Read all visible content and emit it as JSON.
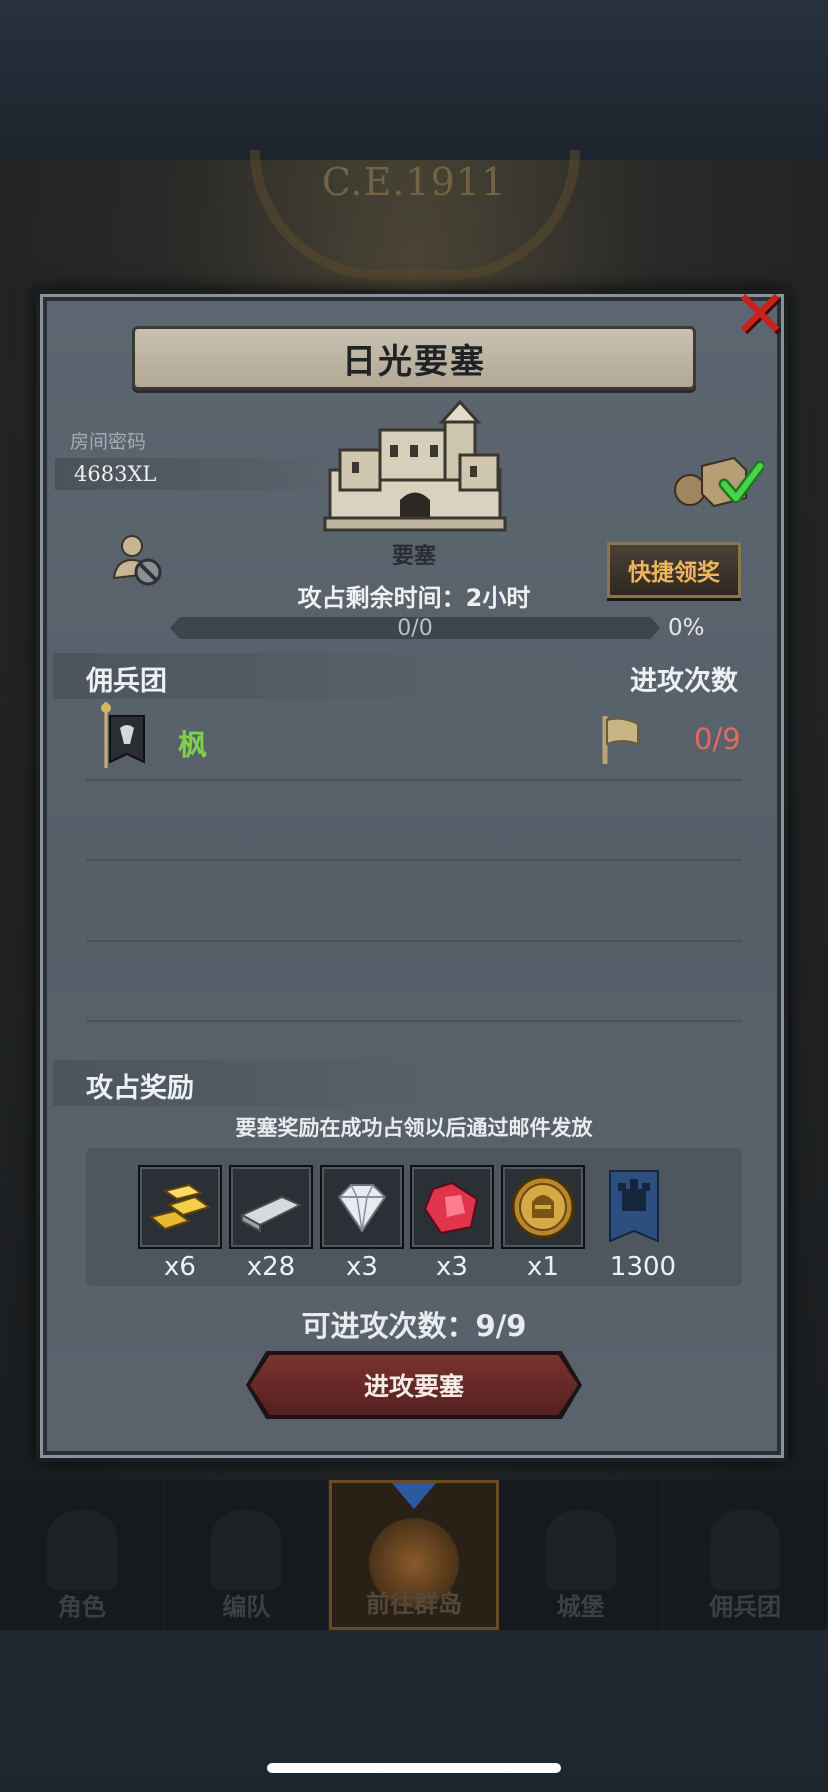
{
  "background": {
    "era_label": "C.E.1911"
  },
  "dialog": {
    "title": "日光要塞",
    "close_icon": "close-x-icon",
    "room": {
      "label": "房间密码",
      "code": "4683XL"
    },
    "fortress": {
      "label": "要塞",
      "time_left": "攻占剩余时间：2小时",
      "progress_text": "0/0",
      "progress_percent": "0%",
      "progress_value": 0
    },
    "quick_claim_label": "快捷领奖",
    "mercenary_section": {
      "title": "佣兵团",
      "attacks_header": "进攻次数",
      "rows": [
        {
          "name": "枫",
          "attacks": "0/9"
        }
      ]
    },
    "rewards_section": {
      "title": "攻占奖励",
      "note": "要塞奖励在成功占领以后通过邮件发放",
      "items": [
        {
          "icon": "gold-bars-icon",
          "qty": "x6"
        },
        {
          "icon": "silver-bar-icon",
          "qty": "x28"
        },
        {
          "icon": "diamond-icon",
          "qty": "x3"
        },
        {
          "icon": "ruby-icon",
          "qty": "x3"
        },
        {
          "icon": "knight-medal-icon",
          "qty": "x1"
        },
        {
          "icon": "castle-banner-icon",
          "qty": "1300"
        }
      ]
    },
    "attack_count": "可进攻次数：9/9",
    "attack_button": "进攻要塞"
  },
  "nav": {
    "items": [
      {
        "label": "角色",
        "icon": "knight-helmet-icon",
        "active": false
      },
      {
        "label": "编队",
        "icon": "formation-icon",
        "active": false
      },
      {
        "label": "前往群岛",
        "icon": "island-compass-icon",
        "active": true
      },
      {
        "label": "城堡",
        "icon": "castle-icon",
        "active": false
      },
      {
        "label": "佣兵团",
        "icon": "mercenary-icon",
        "active": false
      }
    ]
  },
  "colors": {
    "close_red": "#c8231b",
    "merc_name_green": "#7fcf4b",
    "attacks_red": "#e06a62",
    "quick_claim_orange": "#f0b45a",
    "attack_button_red": "#7a3330"
  }
}
